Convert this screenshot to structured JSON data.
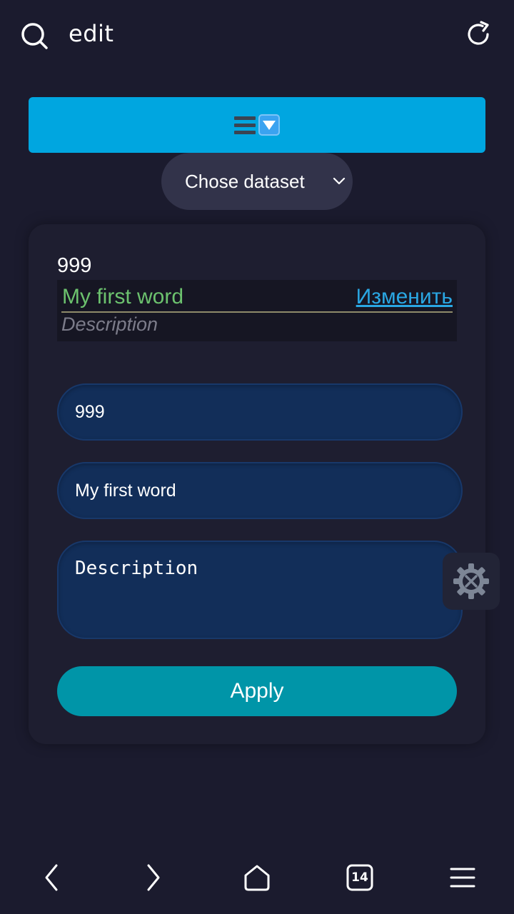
{
  "browser": {
    "url_text": "edit",
    "tab_count": "14"
  },
  "header": {
    "icon_names": [
      "menu-icon",
      "down-arrow-emoji-icon"
    ]
  },
  "dataset_select": {
    "label": "Chose dataset"
  },
  "word_card": {
    "id": "999",
    "word": "My first word",
    "edit_link": "Изменить",
    "description": "Description"
  },
  "form": {
    "id_value": "999",
    "word_value": "My first word",
    "description_placeholder": "Description",
    "apply_label": "Apply"
  },
  "colors": {
    "accent_blue": "#00a6e0",
    "apply_teal": "#0095a8",
    "word_green": "#6cc26e",
    "link_blue": "#2aa7e3",
    "field_bg": "#122e59",
    "page_bg": "#1b1b2e"
  }
}
